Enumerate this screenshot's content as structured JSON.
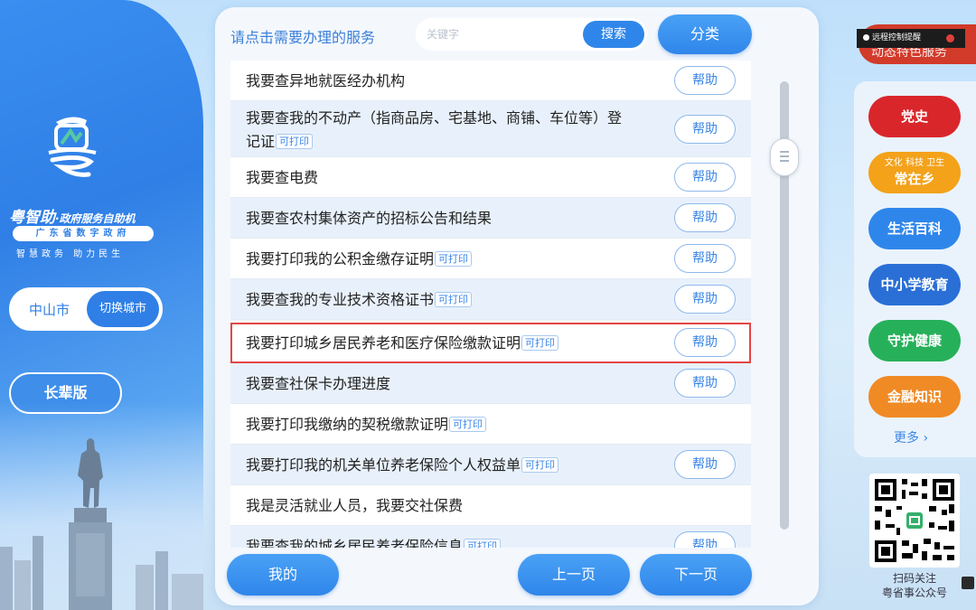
{
  "sidebar": {
    "brand_name": "粤智助",
    "brand_tag": "·政府服务自助机",
    "brand_sub1": "广东省数字政府",
    "brand_sub2": "智慧政务  助力民生",
    "city": "中山市",
    "switch_city": "切换城市",
    "elder_mode": "长辈版"
  },
  "header": {
    "prompt": "请点击需要办理的服务",
    "search_placeholder": "关键字",
    "search_label": "搜索",
    "category_label": "分类"
  },
  "services": [
    {
      "text": "我要查异地就医经办机构",
      "tag": "",
      "help": "帮助"
    },
    {
      "text": "我要查我的不动产（指商品房、宅基地、商铺、车位等）登",
      "text2": "记证",
      "tag": "可打印",
      "help": "帮助"
    },
    {
      "text": "我要查电费",
      "tag": "",
      "help": "帮助"
    },
    {
      "text": "我要查农村集体资产的招标公告和结果",
      "tag": "",
      "help": "帮助"
    },
    {
      "text": "我要打印我的公积金缴存证明",
      "tag": "可打印",
      "help": "帮助"
    },
    {
      "text": "我要查我的专业技术资格证书",
      "tag": "可打印",
      "help": "帮助"
    },
    {
      "text": "我要打印城乡居民养老和医疗保险缴款证明",
      "tag": "可打印",
      "help": "帮助"
    },
    {
      "text": "我要查社保卡办理进度",
      "tag": "",
      "help": "帮助"
    },
    {
      "text": "我要打印我缴纳的契税缴款证明",
      "tag": "可打印",
      "help": ""
    },
    {
      "text": "我要打印我的机关单位养老保险个人权益单",
      "tag": "可打印",
      "help": "帮助"
    },
    {
      "text": "我是灵活就业人员，我要交社保费",
      "tag": "",
      "help": ""
    },
    {
      "text": "我要查我的城乡居民养老保险信息",
      "tag": "可打印",
      "help": "帮助"
    }
  ],
  "footer": {
    "mine": "我的",
    "prev": "上一页",
    "next": "下一页"
  },
  "right": {
    "remote_banner": "动态特色服务",
    "remote_toast": "远程控制提醒",
    "categories": [
      {
        "label": "党史",
        "color": "#d9262b"
      },
      {
        "small": "文化 科技 卫生",
        "label": "常在乡",
        "color": "#f3a21a"
      },
      {
        "label": "生活百科",
        "color": "#2f86ea"
      },
      {
        "label": "中小学教育",
        "color": "#2a6fd6"
      },
      {
        "label": "守护健康",
        "color": "#27b05a"
      },
      {
        "label": "金融知识",
        "color": "#f08a25"
      }
    ],
    "more": "更多 ›",
    "qr_caption1": "扫码关注",
    "qr_caption2": "粤省事公众号"
  }
}
